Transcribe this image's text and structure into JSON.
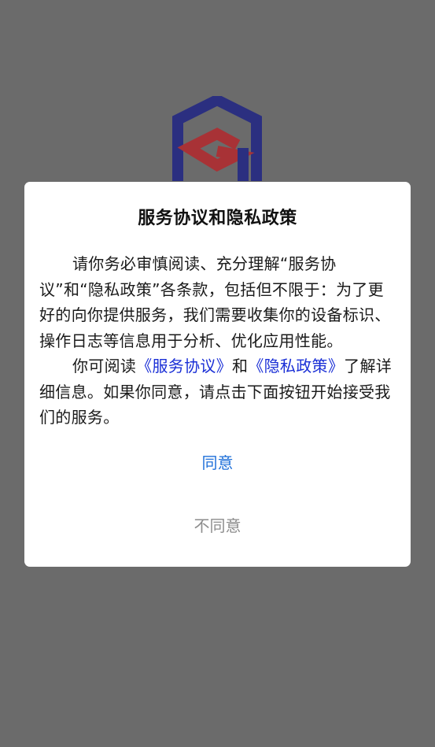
{
  "colors": {
    "overlay_background": "#6b6b6b",
    "dialog_background": "#ffffff",
    "link": "#1a2fd6",
    "agree_button": "#1e6fd9",
    "disagree_button": "#8c8c8c",
    "logo_blue": "#2b2f80",
    "logo_red": "#a83236"
  },
  "logo": {
    "icon": "hexagon-g-logo-icon"
  },
  "dialog": {
    "title": "服务协议和隐私政策",
    "paragraph1": "请你务必审慎阅读、充分理解“服务协议”和“隐私政策”各条款，包括但不限于：为了更好的向你提供服务，我们需要收集你的设备标识、操作日志等信息用于分析、优化应用性能。",
    "paragraph2_prefix": "你可阅读",
    "service_agreement_link": "《服务协议》",
    "paragraph2_and": "和",
    "privacy_policy_link": "《隐私政策》",
    "paragraph2_suffix": "了解详细信息。如果你同意，请点击下面按钮开始接受我们的服务。",
    "agree_label": "同意",
    "disagree_label": "不同意"
  }
}
